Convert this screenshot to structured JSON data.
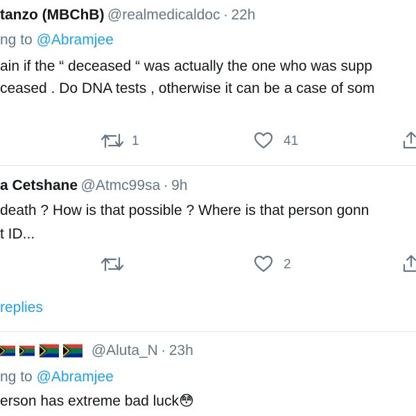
{
  "tweets": [
    {
      "name": "tanzo (MBChB)",
      "handle": "@realmedicaldoc",
      "sep": "·",
      "time": "22h",
      "reply_prefix": "ng to",
      "reply_to": "@Abramjee",
      "lines": [
        "ain if the “ deceased “ was actually the one who was supp",
        "ceased . Do DNA tests , otherwise it can be a case of som"
      ],
      "retweets": "1",
      "likes": "41"
    },
    {
      "name": "a Cetshane",
      "handle": "@Atmc99sa",
      "sep": "·",
      "time": "9h",
      "lines": [
        "death ? How is that possible ? Where is that person gonn",
        "t ID..."
      ],
      "retweets": "",
      "likes": "2"
    },
    {
      "show_replies": "replies"
    },
    {
      "handle": "@Aluta_N",
      "sep": "·",
      "time": "23h",
      "reply_prefix": "ng to",
      "reply_to": "@Abramjee",
      "lines": [
        "erson has extreme bad luck"
      ],
      "emoji": "😳"
    }
  ],
  "colors": {
    "accent": "#1da1f2",
    "muted": "#657786",
    "text": "#14171a",
    "divider": "#e1e8ed"
  },
  "icons": [
    "retweet-icon",
    "heart-icon",
    "share-icon",
    "flag-icon",
    "flushed-face-emoji"
  ]
}
